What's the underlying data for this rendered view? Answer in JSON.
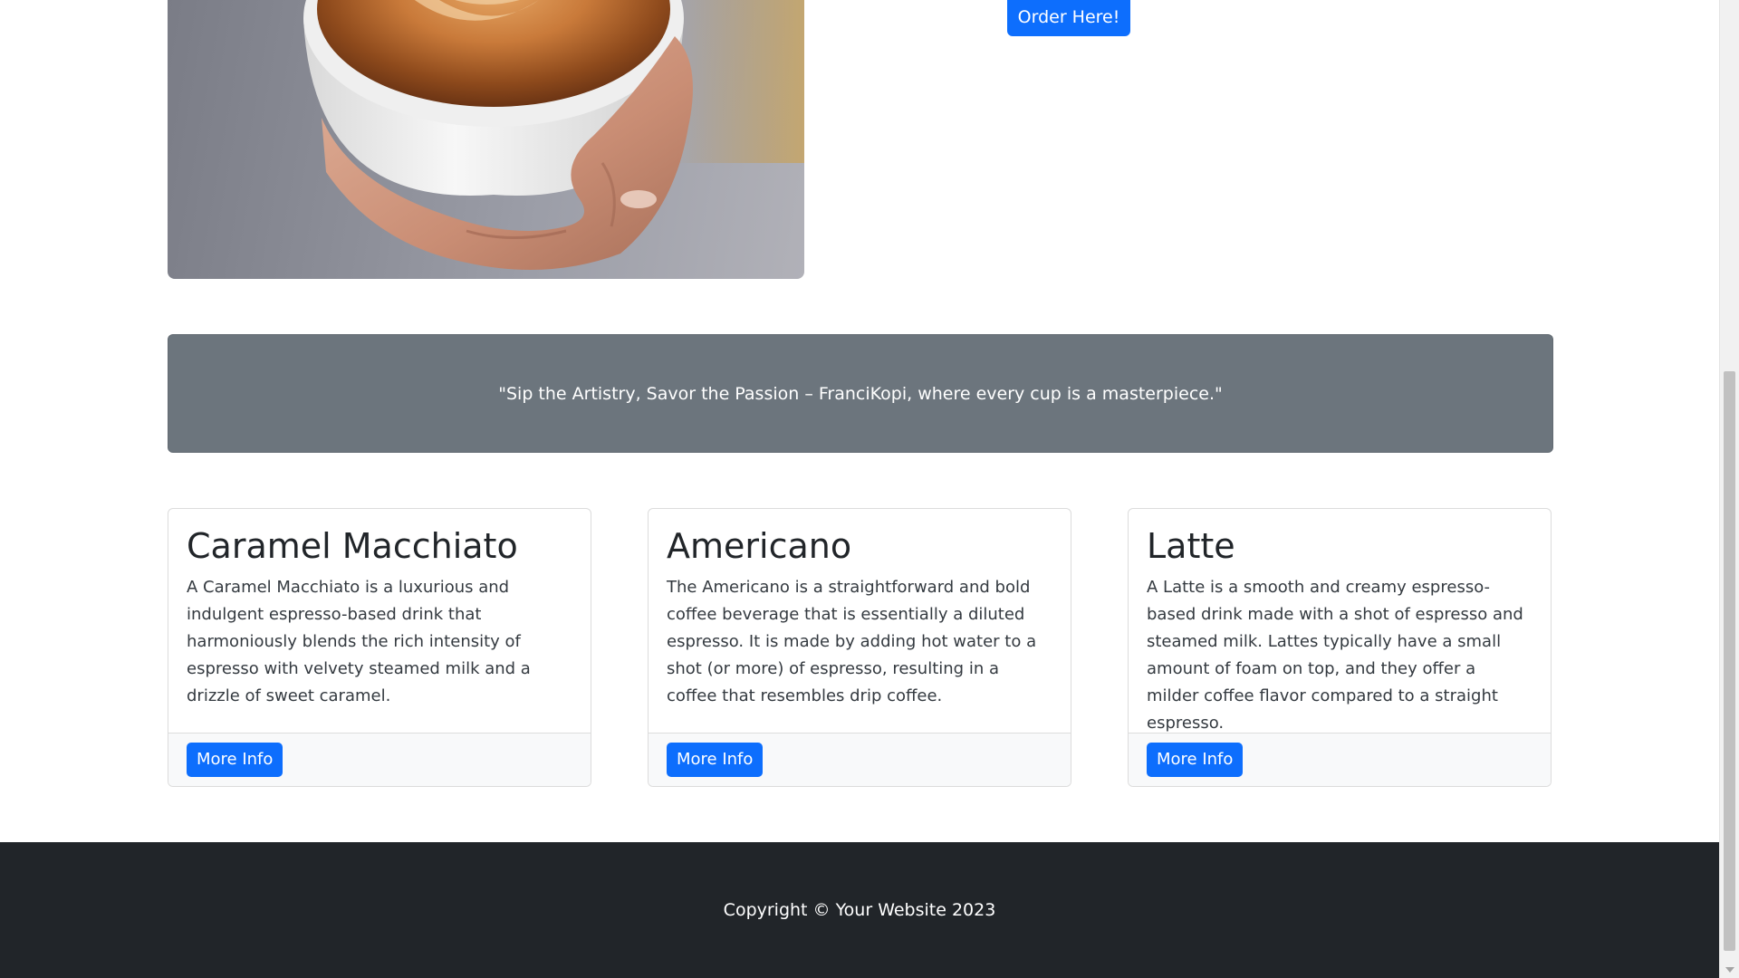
{
  "hero": {
    "image_subject": "latte-art-cup-image",
    "order_button_label": "Order Here!"
  },
  "slogan": {
    "text": "\"Sip the Artistry, Savor the Passion – FranciKopi, where every cup is a masterpiece.\""
  },
  "cards": [
    {
      "title": "Caramel Macchiato",
      "description": "A Caramel Macchiato is a luxurious and indulgent espresso-based drink that harmoniously blends the rich intensity of espresso with velvety steamed milk and a drizzle of sweet caramel.",
      "button_label": "More Info"
    },
    {
      "title": "Americano",
      "description": "The Americano is a straightforward and bold coffee beverage that is essentially a diluted espresso. It is made by adding hot water to a shot (or more) of espresso, resulting in a coffee that resembles drip coffee.",
      "button_label": "More Info"
    },
    {
      "title": "Latte",
      "description": "A Latte is a smooth and creamy espresso-based drink made with a shot of espresso and steamed milk. Lattes typically have a small amount of foam on top, and they offer a milder coffee flavor compared to a straight espresso.",
      "button_label": "More Info"
    }
  ],
  "footer": {
    "copyright": "Copyright © Your Website 2023"
  },
  "colors": {
    "primary": "#0d6efd",
    "banner": "#6c757d",
    "footer": "#212529"
  }
}
